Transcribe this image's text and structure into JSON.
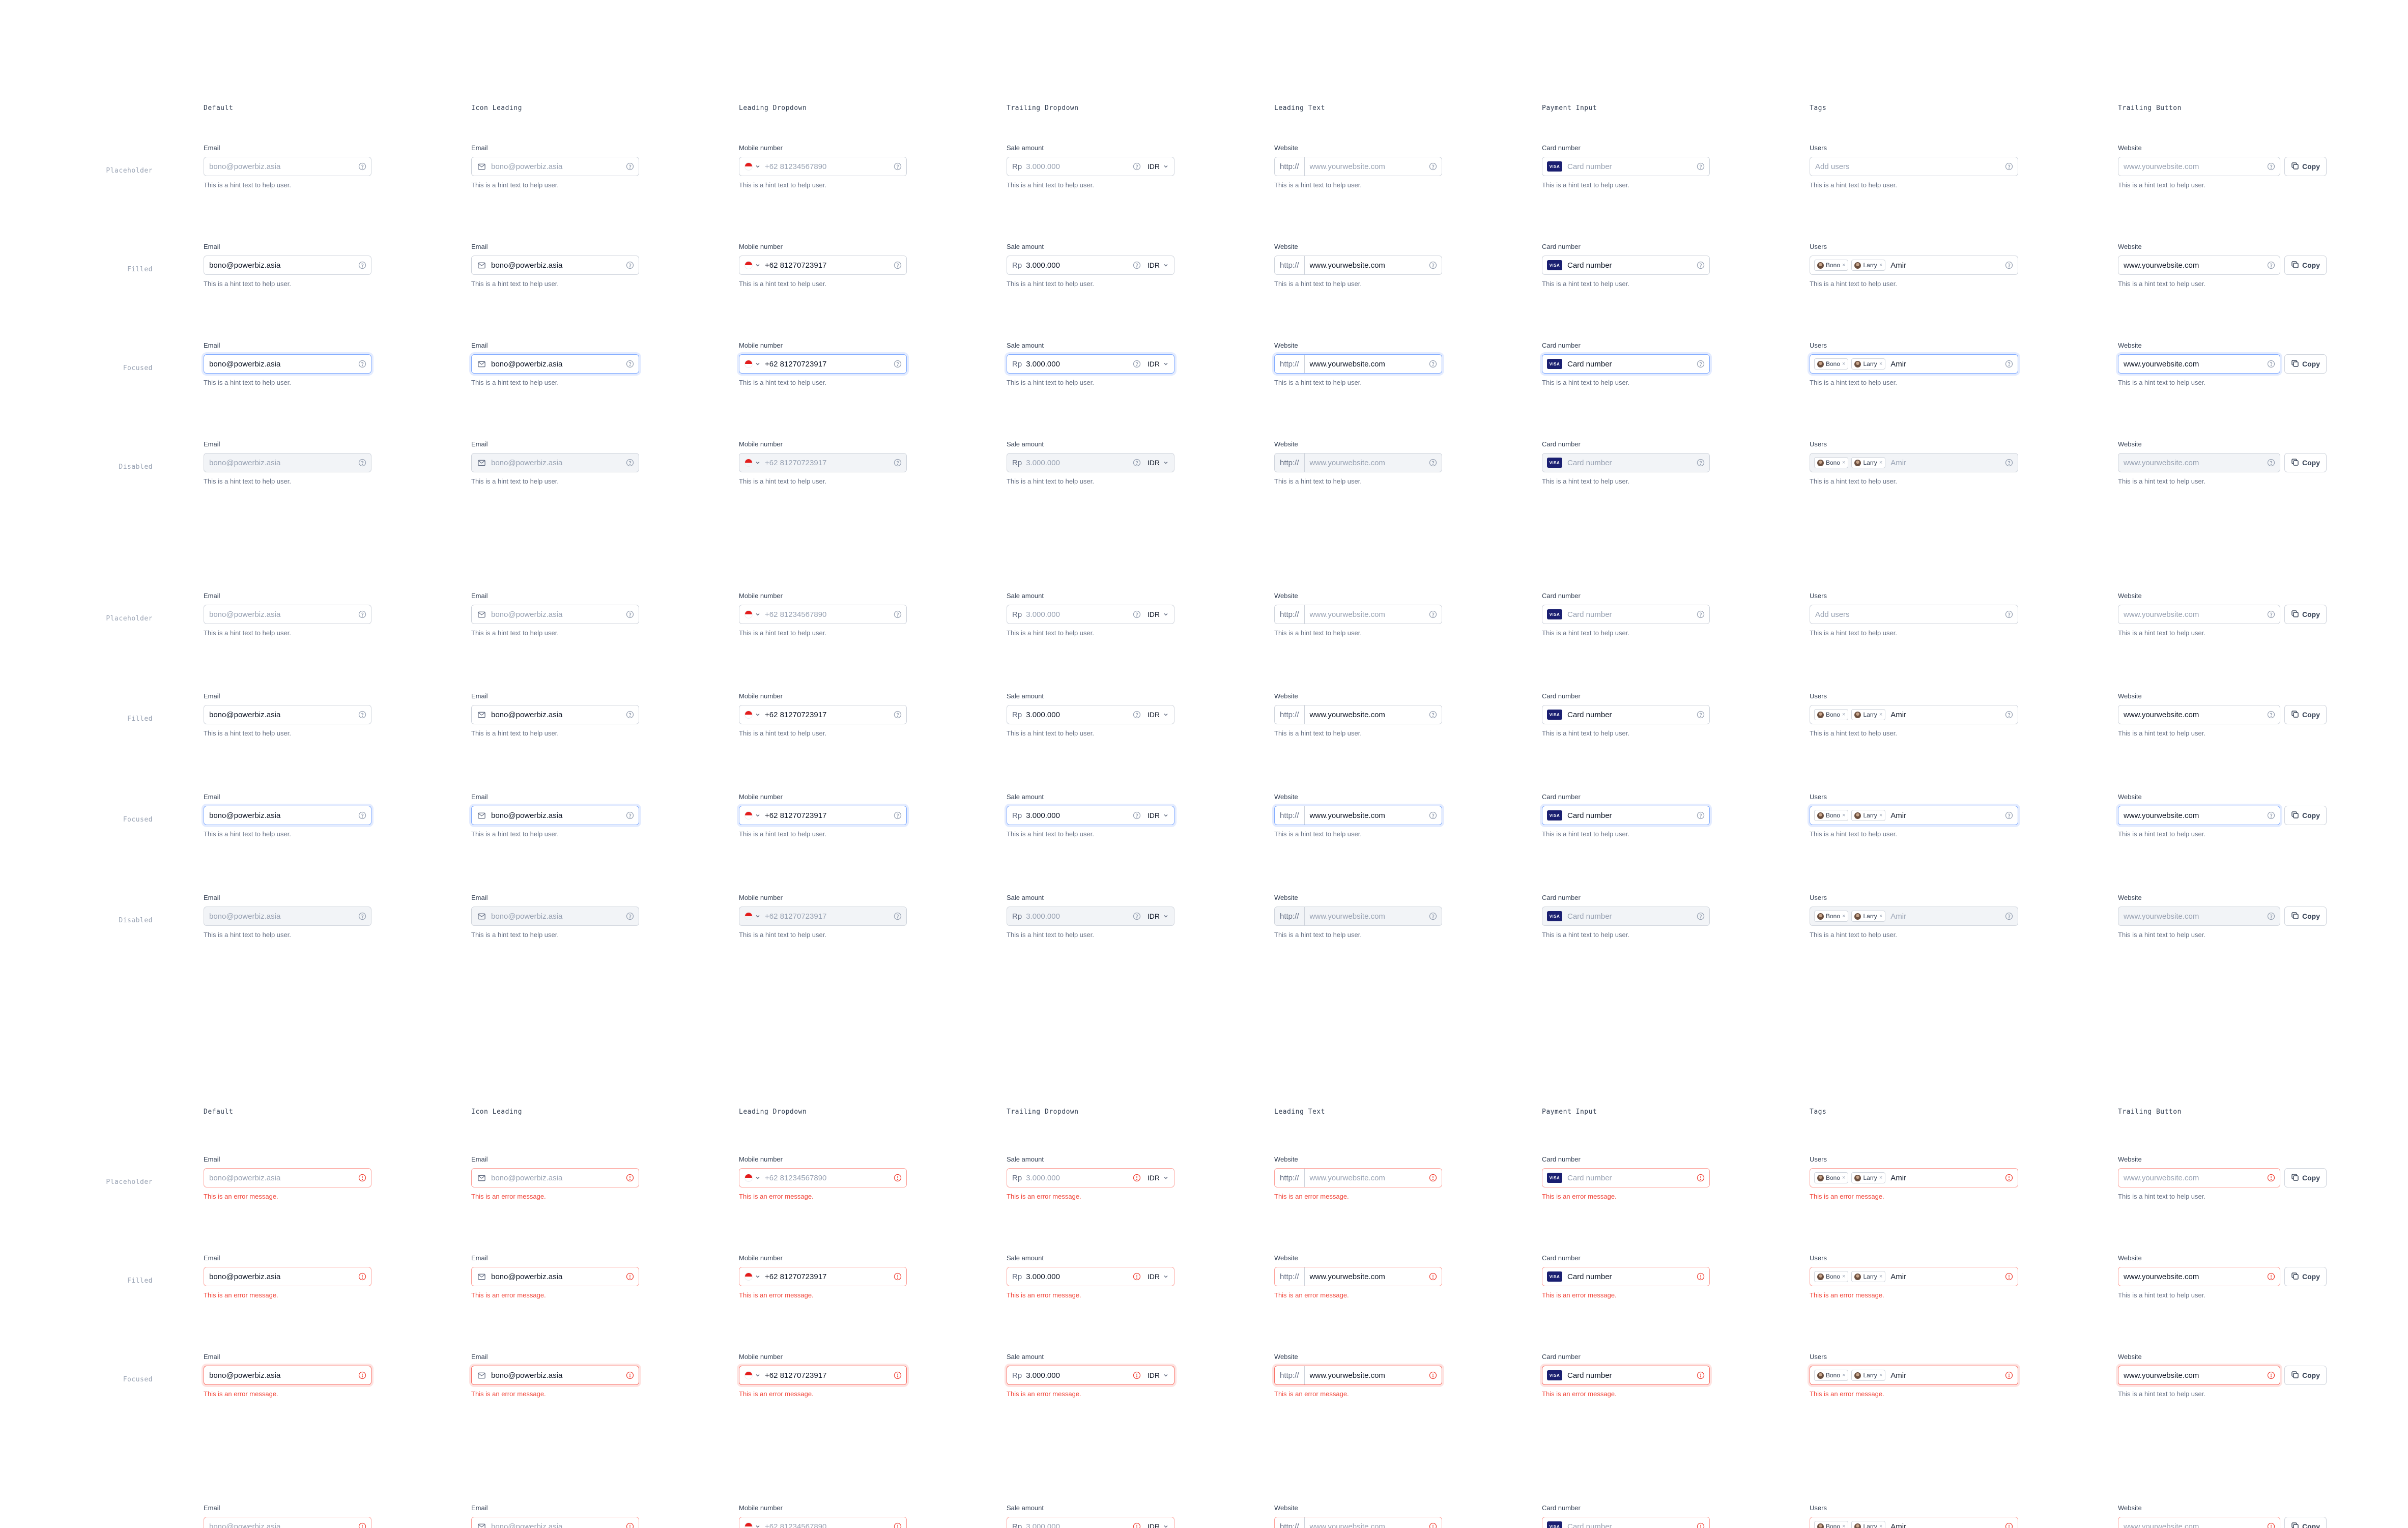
{
  "columns": [
    "Default",
    "Icon Leading",
    "Leading Dropdown",
    "Trailing Dropdown",
    "Leading Text",
    "Payment Input",
    "Tags",
    "Trailing Button"
  ],
  "row_labels": [
    "Placeholder",
    "Filled",
    "Focused",
    "Disabled"
  ],
  "fields": {
    "email_label": "Email",
    "email_value": "bono@powerbiz.asia",
    "mobile_label": "Mobile number",
    "mobile_placeholder": "+62 81234567890",
    "mobile_value": "+62 81270723917",
    "sale_label": "Sale amount",
    "sale_prefix": "Rp",
    "sale_value": "3.000.000",
    "currency": "IDR",
    "website_label": "Website",
    "website_prefix": "http://",
    "website_value": "www.yourwebsite.com",
    "card_label": "Card number",
    "card_value": "Card number",
    "card_brand": "VISA",
    "users_label": "Users",
    "users_placeholder": "Add users",
    "tag1": "Bono",
    "tag2": "Larry",
    "tag_input": "Amir",
    "copy_label": "Copy",
    "hint": "This is a hint text to help user.",
    "error": "This is an error message."
  },
  "colors": {
    "border": "#d0d5dd",
    "focus": "#84adff",
    "error": "#f04438",
    "disabled_bg": "#f2f4f7"
  },
  "icons": [
    "help-circle-icon",
    "mail-icon",
    "chevron-down-icon",
    "copy-icon",
    "alert-circle-icon"
  ]
}
